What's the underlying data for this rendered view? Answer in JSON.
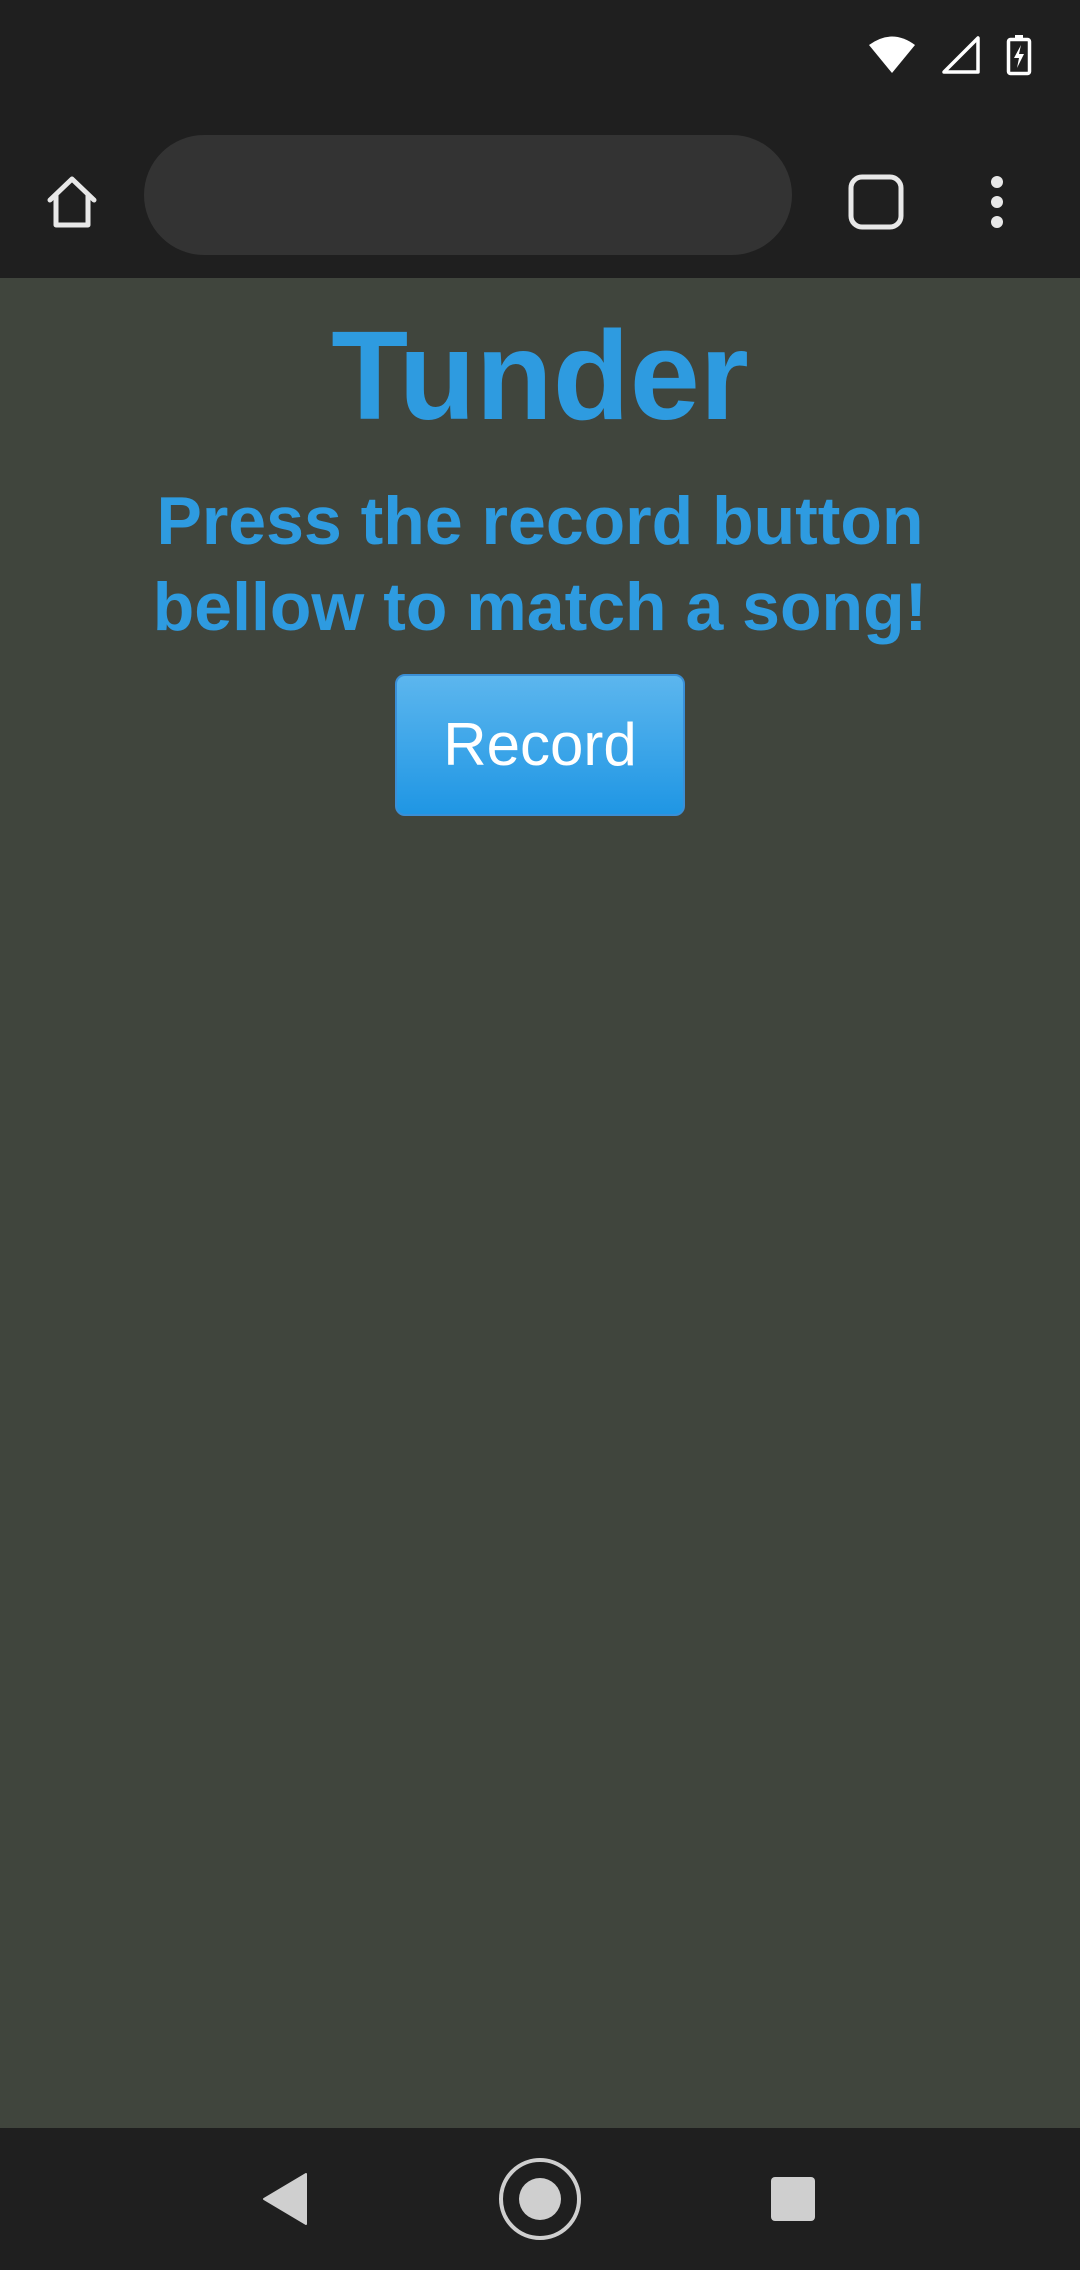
{
  "status_bar": {
    "icons": [
      "wifi-icon",
      "cell-signal-icon",
      "battery-charging-icon"
    ]
  },
  "browser": {
    "home_icon": "home-icon",
    "address_bar": {
      "value": "",
      "placeholder": ""
    },
    "tabs_icon": "tab-switcher-icon",
    "menu_icon": "more-vert-icon"
  },
  "page": {
    "title": "Tunder",
    "instruction": "Press the record button bellow to match a song!",
    "record_button_label": "Record"
  },
  "nav_bar": {
    "icons": [
      "back-icon",
      "home-circle-icon",
      "recents-icon"
    ]
  },
  "colors": {
    "accent": "#2e9be0",
    "page_background": "#40453d",
    "chrome_background": "#1f1f1f",
    "omnibox_background": "#333333",
    "button_text": "#ffffff"
  }
}
